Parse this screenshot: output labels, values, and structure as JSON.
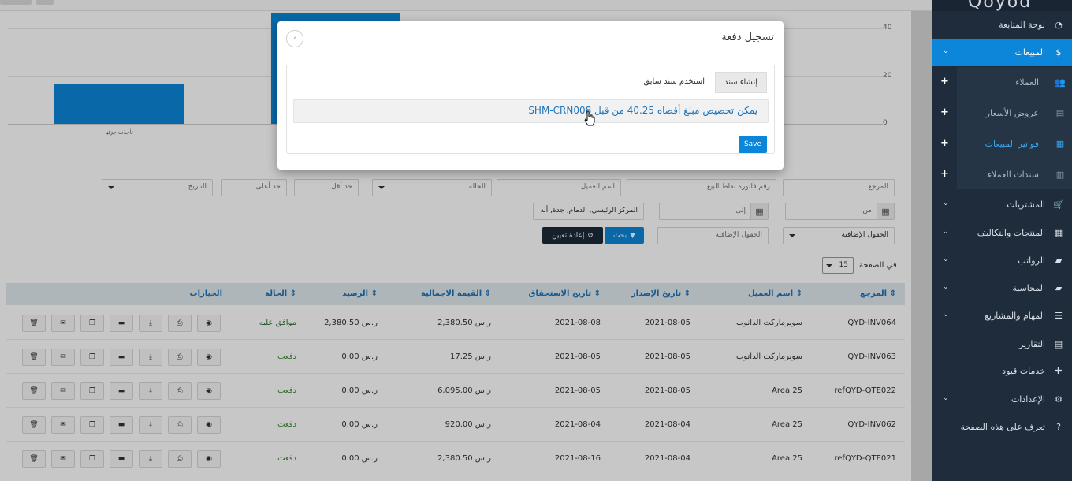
{
  "sidebar": {
    "logo": "Qoyod",
    "items": [
      {
        "label": "لوحة المتابعة",
        "icon": "dashboard-icon"
      },
      {
        "label": "المبيعات",
        "icon": "dollar-icon"
      },
      {
        "label": "العملاء",
        "icon": "users-icon"
      },
      {
        "label": "عروض الأسعار",
        "icon": "document-icon"
      },
      {
        "label": "فواتير المبيعات",
        "icon": "invoice-icon"
      },
      {
        "label": "سندات العملاء",
        "icon": "receipt-icon"
      },
      {
        "label": "المشتريات",
        "icon": "cart-icon"
      },
      {
        "label": "المنتجات والتكاليف",
        "icon": "grid-icon"
      },
      {
        "label": "الرواتب",
        "icon": "folder-icon"
      },
      {
        "label": "المحاسبة",
        "icon": "folder-icon"
      },
      {
        "label": "المهام والمشاريع",
        "icon": "list-icon"
      },
      {
        "label": "التقارير",
        "icon": "file-icon"
      },
      {
        "label": "خدمات قيود",
        "icon": "puzzle-icon"
      },
      {
        "label": "الإعدادات",
        "icon": "gear-icon"
      },
      {
        "label": "تعرف على هذه الصفحة",
        "icon": "question-icon"
      }
    ]
  },
  "chart_data": {
    "type": "bar",
    "ylim": [
      0,
      40
    ],
    "yticks": [
      "40",
      "20",
      "0"
    ],
    "categories": [
      "تأخذت جزئيا"
    ],
    "values": [
      17
    ],
    "hidden_bar_value": 40
  },
  "filters": {
    "reference_placeholder": "المرجع",
    "pos_invoice_placeholder": "رقم فاتورة نقاط البيع",
    "customer_placeholder": "اسم العميل",
    "status_placeholder": "الحالة",
    "min_placeholder": "حد أقل",
    "max_placeholder": "حد أعلى",
    "date_placeholder": "التاريخ",
    "from_placeholder": "من",
    "to_placeholder": "إلى",
    "location_value": "المركز الرئيسي, الدمام, جدة, أبه",
    "extra_fields_select": "الحقول الإضافية",
    "extra_fields_input": "الحقول الإضافية",
    "search_label": "بحث",
    "reset_label": "إعادة تعيين"
  },
  "pagination": {
    "per_page_label": "في الصفحة",
    "per_page_value": "15"
  },
  "table": {
    "headers": [
      "المرجع",
      "اسم العميل",
      "تاريخ الإصدار",
      "تاريخ الاستحقاق",
      "القيمة الاجمالية",
      "الرصيد",
      "الحالة",
      "الخيارات"
    ],
    "rows": [
      {
        "ref": "QYD-INV064",
        "customer": "سوبرماركت الدانوب",
        "issue": "2021-08-05",
        "due": "2021-08-08",
        "total": "2,380.50 ر.س",
        "balance": "2,380.50 ر.س",
        "status": "موافق عليه"
      },
      {
        "ref": "QYD-INV063",
        "customer": "سوبرماركت الدانوب",
        "issue": "2021-08-05",
        "due": "2021-08-05",
        "total": "17.25 ر.س",
        "balance": "0.00 ر.س",
        "status": "دفعت"
      },
      {
        "ref": "refQYD-QTE022",
        "customer": "Area 25",
        "issue": "2021-08-05",
        "due": "2021-08-05",
        "total": "6,095.00 ر.س",
        "balance": "0.00 ر.س",
        "status": "دفعت"
      },
      {
        "ref": "QYD-INV062",
        "customer": "Area 25",
        "issue": "2021-08-04",
        "due": "2021-08-04",
        "total": "920.00 ر.س",
        "balance": "0.00 ر.س",
        "status": "دفعت"
      },
      {
        "ref": "refQYD-QTE021",
        "customer": "Area 25",
        "issue": "2021-08-04",
        "due": "2021-08-16",
        "total": "2,380.50 ر.س",
        "balance": "0.00 ر.س",
        "status": "دفعت"
      }
    ],
    "actions": [
      "view-icon",
      "print-icon",
      "download-icon",
      "card-icon",
      "copy-icon",
      "email-icon",
      "delete-icon"
    ]
  },
  "modal": {
    "title": "تسجيل دفعة",
    "tab_create": "إنشاء سند",
    "tab_use_previous": "استخدم سند سابق",
    "allocation_text": "يمكن تخصيص مبلغ أقصاه 40.25 من قبل SHM-CRN008",
    "save_label": "Save"
  },
  "colors": {
    "accent": "#0b86d8",
    "sidebar": "#1f2c3b",
    "link": "#1f73b7",
    "paid": "#3c8a3c"
  }
}
